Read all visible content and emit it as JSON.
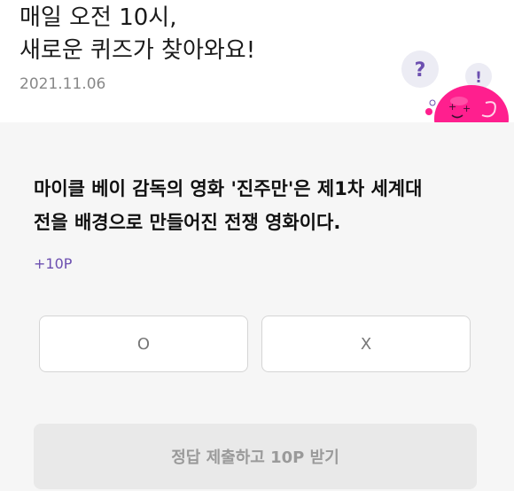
{
  "header": {
    "headline_line1": "매일 오전 10시,",
    "headline_line2": "새로운 퀴즈가 찾아와요!",
    "date": "2021.11.06",
    "mascot_icon": "pink-blob-mascot-icon"
  },
  "quiz": {
    "question_line1": "마이클 베이 감독의 영화 '진주만'은 제1차 세계대",
    "question_line2": "전을 배경으로 만들어진 전쟁 영화이다.",
    "points": "+10P",
    "option_o": "O",
    "option_x": "X",
    "submit_label": "정답 제출하고 10P 받기"
  },
  "colors": {
    "accent_purple": "#6c4fb0",
    "mascot_pink": "#ff1f8e",
    "quiz_bg": "#f6f6f6"
  }
}
